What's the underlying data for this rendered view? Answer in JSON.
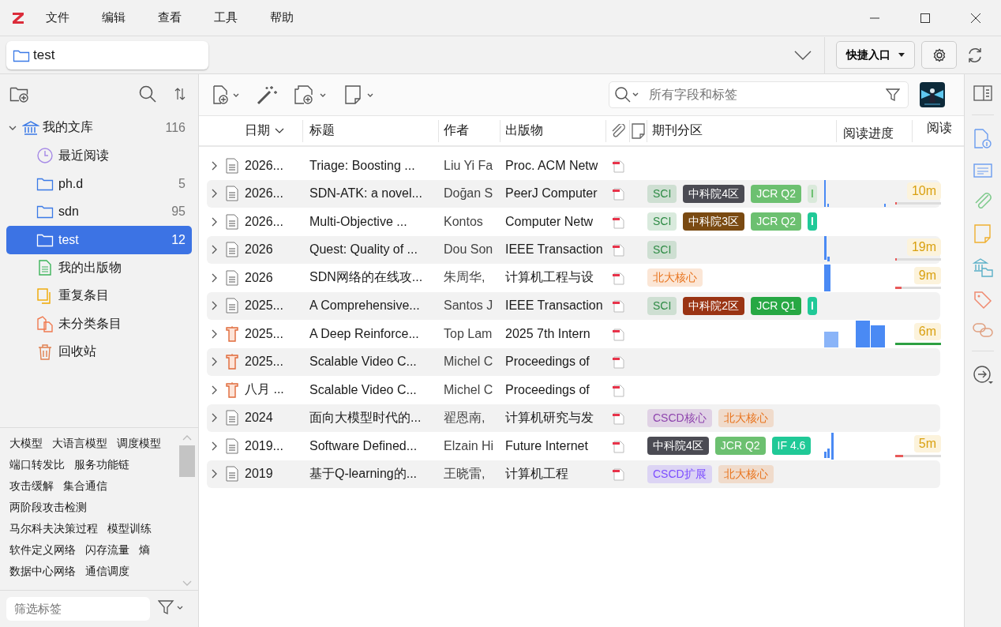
{
  "menu": [
    "文件",
    "编辑",
    "查看",
    "工具",
    "帮助"
  ],
  "location": {
    "value": "test"
  },
  "quick_access": "快捷入口",
  "search": {
    "placeholder": "所有字段和标签"
  },
  "library": {
    "label": "我的文库",
    "count": "116",
    "expanded": true,
    "children": [
      {
        "label": "最近阅读",
        "kind": "recent",
        "selected": false
      },
      {
        "label": "ph.d",
        "kind": "folder",
        "count": "5",
        "selected": false
      },
      {
        "label": "sdn",
        "kind": "folder",
        "count": "95",
        "selected": false
      },
      {
        "label": "test",
        "kind": "folder",
        "count": "12",
        "selected": true
      },
      {
        "label": "我的出版物",
        "kind": "publications",
        "selected": false
      },
      {
        "label": "重复条目",
        "kind": "duplicates",
        "selected": false
      },
      {
        "label": "未分类条目",
        "kind": "unfiled",
        "selected": false
      },
      {
        "label": "回收站",
        "kind": "trash",
        "selected": false
      }
    ]
  },
  "tags": [
    "大模型",
    "大语言模型",
    "调度模型",
    "端口转发比",
    "服务功能链",
    "攻击缓解",
    "集合通信",
    "两阶段攻击检测",
    "马尔科夫决策过程",
    "模型训练",
    "软件定义网络",
    "闪存流量",
    "熵",
    "数据中心网络",
    "通信调度"
  ],
  "tag_filter": {
    "placeholder": "筛选标签"
  },
  "columns": [
    "日期",
    "标题",
    "作者",
    "出版物",
    "期刊分区",
    "阅读进度",
    "阅读"
  ],
  "rows": [
    {
      "kind": "article",
      "date": "2026...",
      "title": "Triage: Boosting ...",
      "author": "Liu Yi Fa",
      "publication": "Proc. ACM Netw",
      "tags": []
    },
    {
      "kind": "article",
      "date": "2026...",
      "title": "SDN-ATK: a novel...",
      "author": "Doğan S",
      "publication": "PeerJ Computer",
      "tags": [
        {
          "text": "SCI",
          "kind": "soft",
          "color": "#2e8b45"
        },
        {
          "text": "中科院4区",
          "kind": "solid",
          "color": "#4b4b53"
        },
        {
          "text": "JCR Q2",
          "kind": "solid",
          "color": "#6cc070"
        },
        {
          "text": "I",
          "kind": "soft",
          "color": "#6cc070"
        }
      ],
      "read": "10m",
      "level": 0.03
    },
    {
      "kind": "article",
      "date": "2026...",
      "title": "Multi-Objective ...",
      "author": "Kontos",
      "publication": "Computer Netw",
      "tags": [
        {
          "text": "SCI",
          "kind": "soft",
          "color": "#2e8b45"
        },
        {
          "text": "中科院3区",
          "kind": "solid",
          "color": "#7a4a12"
        },
        {
          "text": "JCR Q2",
          "kind": "solid",
          "color": "#6cc070"
        },
        {
          "text": "I",
          "kind": "solid",
          "color": "#20c997"
        }
      ]
    },
    {
      "kind": "article",
      "date": "2026",
      "title": "Quest: Quality of ...",
      "author": "Dou Son",
      "publication": "IEEE Transaction",
      "tags": [
        {
          "text": "SCI",
          "kind": "soft",
          "color": "#2e8b45"
        }
      ],
      "read": "19m",
      "level": 0.03
    },
    {
      "kind": "article",
      "date": "2026",
      "title": "SDN网络的在线攻...",
      "author": "朱周华,",
      "publication": "计算机工程与设",
      "tags": [
        {
          "text": "北大核心",
          "kind": "soft",
          "color": "#e8741e"
        }
      ],
      "read": "9m",
      "level": 0.14
    },
    {
      "kind": "article",
      "date": "2025...",
      "title": "A Comprehensive...",
      "author": "Santos J",
      "publication": "IEEE Transaction",
      "tags": [
        {
          "text": "SCI",
          "kind": "soft",
          "color": "#2e8b45"
        },
        {
          "text": "中科院2区",
          "kind": "solid",
          "color": "#9a3414"
        },
        {
          "text": "JCR Q1",
          "kind": "solid",
          "color": "#27a844"
        },
        {
          "text": "I",
          "kind": "solid",
          "color": "#20c997"
        }
      ]
    },
    {
      "kind": "conference",
      "date": "2025...",
      "title": "A Deep Reinforce...",
      "author": "Top Lam",
      "publication": "2025 7th Intern",
      "tags": [],
      "read": "6m",
      "level": 1
    },
    {
      "kind": "conference",
      "date": "2025...",
      "title": "Scalable Video C...",
      "author": "Michel C",
      "publication": "Proceedings of",
      "tags": []
    },
    {
      "kind": "conference",
      "date": "八月 ...",
      "title": "Scalable Video C...",
      "author": "Michel C",
      "publication": "Proceedings of",
      "tags": []
    },
    {
      "kind": "article",
      "date": "2024",
      "title": "面向大模型时代的...",
      "author": "翟恩南,",
      "publication": "计算机研究与发",
      "tags": [
        {
          "text": "CSCD核心",
          "kind": "soft",
          "color": "#8e44ad"
        },
        {
          "text": "北大核心",
          "kind": "soft",
          "color": "#e8741e"
        }
      ]
    },
    {
      "kind": "article",
      "date": "2019...",
      "title": "Software Defined...",
      "author": "Elzain Hi",
      "publication": "Future Internet",
      "tags": [
        {
          "text": "中科院4区",
          "kind": "solid",
          "color": "#4b4b53"
        },
        {
          "text": "JCR Q2",
          "kind": "solid",
          "color": "#6cc070"
        },
        {
          "text": "IF 4.6",
          "kind": "solid",
          "color": "#20c997"
        }
      ],
      "read": "5m",
      "level": 0.18
    },
    {
      "kind": "article",
      "date": "2019",
      "title": "基于Q-learning的...",
      "author": "王晓雷,",
      "publication": "计算机工程",
      "tags": [
        {
          "text": "CSCD扩展",
          "kind": "soft",
          "color": "#7c4dff"
        },
        {
          "text": "北大核心",
          "kind": "soft",
          "color": "#e8741e"
        }
      ]
    }
  ]
}
